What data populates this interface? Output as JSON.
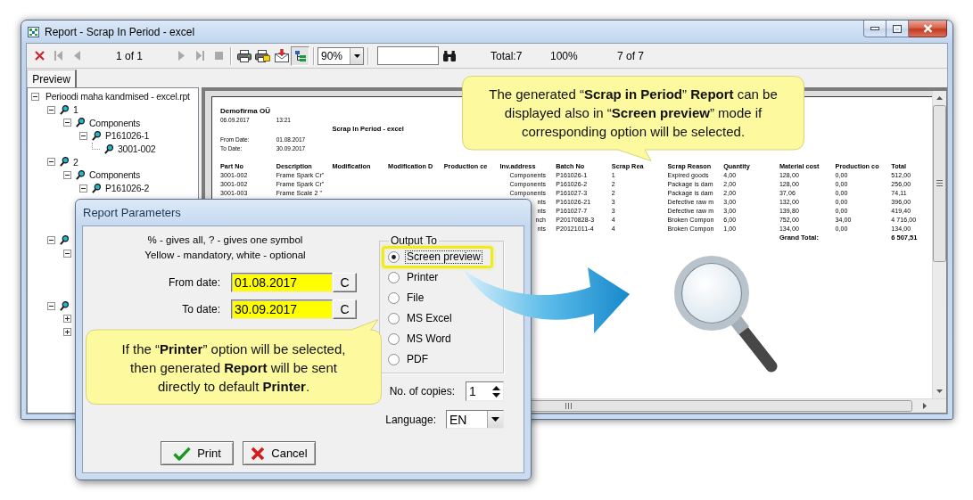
{
  "window": {
    "title": "Report - Scrap In Period - excel"
  },
  "toolbar": {
    "nav": [
      {
        "kind": "close",
        "disabled": false
      },
      {
        "kind": "first",
        "disabled": true
      },
      {
        "kind": "previous",
        "disabled": true
      }
    ],
    "page": "1 of 1",
    "nav_end": [
      {
        "kind": "next",
        "disabled": true
      },
      {
        "kind": "last",
        "disabled": true
      },
      {
        "kind": "stop",
        "disabled": true
      }
    ],
    "tools": [
      {
        "kind": "print",
        "pressed": false
      },
      {
        "kind": "printer_setup",
        "pressed": false
      },
      {
        "kind": "export",
        "pressed": false
      },
      {
        "kind": "group_tree",
        "pressed": true
      }
    ],
    "zoom": "90%",
    "counters": [
      "Total:7",
      "100%",
      "7 of 7"
    ]
  },
  "tabs": [
    {
      "label": "Preview",
      "selected": true
    }
  ],
  "tree": {
    "label": "Perioodi maha kandmised - excel.rpt",
    "expanded": true,
    "children": [
      {
        "label": "1",
        "expanded": true,
        "children": [
          {
            "label": "Components",
            "expanded": true,
            "children": [
              {
                "label": "P161026-1",
                "expanded": true,
                "children": [
                  {
                    "label": "3001-002"
                  }
                ]
              }
            ]
          }
        ]
      },
      {
        "label": "2",
        "expanded": true,
        "children": [
          {
            "label": "Components",
            "expanded": true,
            "children": [
              {
                "label": "P161026-2",
                "expanded": true
              }
            ]
          }
        ]
      },
      {
        "expanded": true,
        "children": [
          {
            "expanded": true
          }
        ]
      },
      {
        "expanded": true,
        "children": [
          {
            "expanded": false
          },
          {
            "expanded": false
          }
        ]
      }
    ]
  },
  "report": {
    "company": "Demofirma OÜ",
    "date": "06.09.2017",
    "time": "13:21",
    "title": "Scrap In Period - excel",
    "period": [
      {
        "label": "From Date:",
        "value": "01.08.2017"
      },
      {
        "label": "To Date:",
        "value": "30.09.2017"
      }
    ],
    "columns": [
      "Part No",
      "Description",
      "Modification",
      "Modification D",
      "Production ce",
      "Inv.address",
      "Batch No",
      "Scrap Rea",
      "Scrap Reason",
      "Quantity",
      "Material cost",
      "Production co",
      "Total"
    ],
    "rows": [
      [
        "3001-002",
        "Frame Spark Cr\"",
        null,
        null,
        null,
        "Components",
        "P161026-1",
        "1",
        "Expired goods",
        "4,00",
        "128,00",
        "0,00",
        "512,00"
      ],
      [
        "3001-002",
        "Frame Spark Cr\"",
        null,
        null,
        null,
        "Components",
        "P161026-2",
        "2",
        "Package is dam",
        "2,00",
        "128,00",
        "0,00",
        "256,00"
      ],
      [
        "3001-003",
        "Frame Scale 2 \"",
        null,
        null,
        null,
        "Components",
        "P161027-3",
        "2",
        "Package is dam",
        "2,00",
        "37,06",
        "0,00",
        "74,11"
      ],
      [
        null,
        null,
        null,
        null,
        null,
        "nts",
        "P161026-21",
        "3",
        "Defective raw m",
        "3,00",
        "132,00",
        "0,00",
        "396,00"
      ],
      [
        null,
        null,
        null,
        null,
        null,
        "nts",
        "P161027-7",
        "3",
        "Defective raw m",
        "3,00",
        "139,80",
        "0,00",
        "419,40"
      ],
      [
        null,
        null,
        null,
        null,
        null,
        "nch",
        "P20170828-3",
        "4",
        "Broken Compon",
        "6,00",
        "752,00",
        "34,00",
        "4 716,00"
      ],
      [
        null,
        null,
        null,
        null,
        null,
        "nts",
        "P20121011-4",
        "4",
        "Broken Compon",
        "1,00",
        "134,00",
        "0,00",
        "134,00"
      ]
    ],
    "grand_total": {
      "label": "Grand Total:",
      "value": "6 507,51"
    }
  },
  "dialog": {
    "title": "Report Parameters",
    "hints": [
      "% - gives all, ? - gives one symbol",
      "Yellow - mandatory, white - optional"
    ],
    "fields": [
      {
        "label": "From date:",
        "value": "01.08.2017",
        "button": "C",
        "mandatory": true
      },
      {
        "label": "To date:",
        "value": "30.09.2017",
        "button": "C",
        "mandatory": true
      }
    ],
    "output": {
      "legend": "Output To",
      "options": [
        {
          "label": "Screen preview",
          "selected": true,
          "highlighted": true
        },
        {
          "label": "Printer",
          "selected": false,
          "highlighted": false
        },
        {
          "label": "File",
          "selected": false,
          "highlighted": false
        },
        {
          "label": "MS Excel",
          "selected": false,
          "highlighted": false
        },
        {
          "label": "MS Word",
          "selected": false,
          "highlighted": false
        },
        {
          "label": "PDF",
          "selected": false,
          "highlighted": false
        }
      ]
    },
    "copies": {
      "label": "No. of copies:",
      "value": "1"
    },
    "language": {
      "label": "Language:",
      "value": "EN"
    },
    "buttons": [
      {
        "kind": "confirm",
        "label": "Print"
      },
      {
        "kind": "cancel",
        "label": "Cancel"
      }
    ]
  },
  "callouts": [
    {
      "text": "The generated “**Scrap in Period**” **Report** can be displayed also in “**Screen preview**” mode if corresponding option will be selected."
    },
    {
      "text": "If the “**Printer**” option will be selected, then generated **Report** will be sent directly to default **Printer**."
    }
  ]
}
